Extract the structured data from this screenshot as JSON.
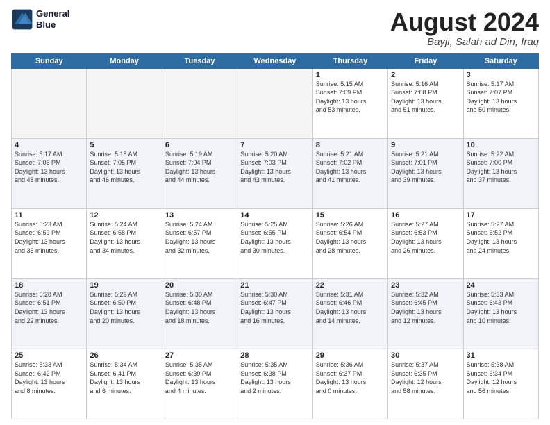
{
  "header": {
    "logo_line1": "General",
    "logo_line2": "Blue",
    "title": "August 2024",
    "location": "Bayji, Salah ad Din, Iraq"
  },
  "days_of_week": [
    "Sunday",
    "Monday",
    "Tuesday",
    "Wednesday",
    "Thursday",
    "Friday",
    "Saturday"
  ],
  "weeks": [
    {
      "days": [
        {
          "num": "",
          "empty": true
        },
        {
          "num": "",
          "empty": true
        },
        {
          "num": "",
          "empty": true
        },
        {
          "num": "",
          "empty": true
        },
        {
          "num": "1",
          "info": "Sunrise: 5:15 AM\nSunset: 7:09 PM\nDaylight: 13 hours\nand 53 minutes."
        },
        {
          "num": "2",
          "info": "Sunrise: 5:16 AM\nSunset: 7:08 PM\nDaylight: 13 hours\nand 51 minutes."
        },
        {
          "num": "3",
          "info": "Sunrise: 5:17 AM\nSunset: 7:07 PM\nDaylight: 13 hours\nand 50 minutes."
        }
      ]
    },
    {
      "days": [
        {
          "num": "4",
          "info": "Sunrise: 5:17 AM\nSunset: 7:06 PM\nDaylight: 13 hours\nand 48 minutes."
        },
        {
          "num": "5",
          "info": "Sunrise: 5:18 AM\nSunset: 7:05 PM\nDaylight: 13 hours\nand 46 minutes."
        },
        {
          "num": "6",
          "info": "Sunrise: 5:19 AM\nSunset: 7:04 PM\nDaylight: 13 hours\nand 44 minutes."
        },
        {
          "num": "7",
          "info": "Sunrise: 5:20 AM\nSunset: 7:03 PM\nDaylight: 13 hours\nand 43 minutes."
        },
        {
          "num": "8",
          "info": "Sunrise: 5:21 AM\nSunset: 7:02 PM\nDaylight: 13 hours\nand 41 minutes."
        },
        {
          "num": "9",
          "info": "Sunrise: 5:21 AM\nSunset: 7:01 PM\nDaylight: 13 hours\nand 39 minutes."
        },
        {
          "num": "10",
          "info": "Sunrise: 5:22 AM\nSunset: 7:00 PM\nDaylight: 13 hours\nand 37 minutes."
        }
      ]
    },
    {
      "days": [
        {
          "num": "11",
          "info": "Sunrise: 5:23 AM\nSunset: 6:59 PM\nDaylight: 13 hours\nand 35 minutes."
        },
        {
          "num": "12",
          "info": "Sunrise: 5:24 AM\nSunset: 6:58 PM\nDaylight: 13 hours\nand 34 minutes."
        },
        {
          "num": "13",
          "info": "Sunrise: 5:24 AM\nSunset: 6:57 PM\nDaylight: 13 hours\nand 32 minutes."
        },
        {
          "num": "14",
          "info": "Sunrise: 5:25 AM\nSunset: 6:55 PM\nDaylight: 13 hours\nand 30 minutes."
        },
        {
          "num": "15",
          "info": "Sunrise: 5:26 AM\nSunset: 6:54 PM\nDaylight: 13 hours\nand 28 minutes."
        },
        {
          "num": "16",
          "info": "Sunrise: 5:27 AM\nSunset: 6:53 PM\nDaylight: 13 hours\nand 26 minutes."
        },
        {
          "num": "17",
          "info": "Sunrise: 5:27 AM\nSunset: 6:52 PM\nDaylight: 13 hours\nand 24 minutes."
        }
      ]
    },
    {
      "days": [
        {
          "num": "18",
          "info": "Sunrise: 5:28 AM\nSunset: 6:51 PM\nDaylight: 13 hours\nand 22 minutes."
        },
        {
          "num": "19",
          "info": "Sunrise: 5:29 AM\nSunset: 6:50 PM\nDaylight: 13 hours\nand 20 minutes."
        },
        {
          "num": "20",
          "info": "Sunrise: 5:30 AM\nSunset: 6:48 PM\nDaylight: 13 hours\nand 18 minutes."
        },
        {
          "num": "21",
          "info": "Sunrise: 5:30 AM\nSunset: 6:47 PM\nDaylight: 13 hours\nand 16 minutes."
        },
        {
          "num": "22",
          "info": "Sunrise: 5:31 AM\nSunset: 6:46 PM\nDaylight: 13 hours\nand 14 minutes."
        },
        {
          "num": "23",
          "info": "Sunrise: 5:32 AM\nSunset: 6:45 PM\nDaylight: 13 hours\nand 12 minutes."
        },
        {
          "num": "24",
          "info": "Sunrise: 5:33 AM\nSunset: 6:43 PM\nDaylight: 13 hours\nand 10 minutes."
        }
      ]
    },
    {
      "days": [
        {
          "num": "25",
          "info": "Sunrise: 5:33 AM\nSunset: 6:42 PM\nDaylight: 13 hours\nand 8 minutes."
        },
        {
          "num": "26",
          "info": "Sunrise: 5:34 AM\nSunset: 6:41 PM\nDaylight: 13 hours\nand 6 minutes."
        },
        {
          "num": "27",
          "info": "Sunrise: 5:35 AM\nSunset: 6:39 PM\nDaylight: 13 hours\nand 4 minutes."
        },
        {
          "num": "28",
          "info": "Sunrise: 5:35 AM\nSunset: 6:38 PM\nDaylight: 13 hours\nand 2 minutes."
        },
        {
          "num": "29",
          "info": "Sunrise: 5:36 AM\nSunset: 6:37 PM\nDaylight: 13 hours\nand 0 minutes."
        },
        {
          "num": "30",
          "info": "Sunrise: 5:37 AM\nSunset: 6:35 PM\nDaylight: 12 hours\nand 58 minutes."
        },
        {
          "num": "31",
          "info": "Sunrise: 5:38 AM\nSunset: 6:34 PM\nDaylight: 12 hours\nand 56 minutes."
        }
      ]
    }
  ]
}
